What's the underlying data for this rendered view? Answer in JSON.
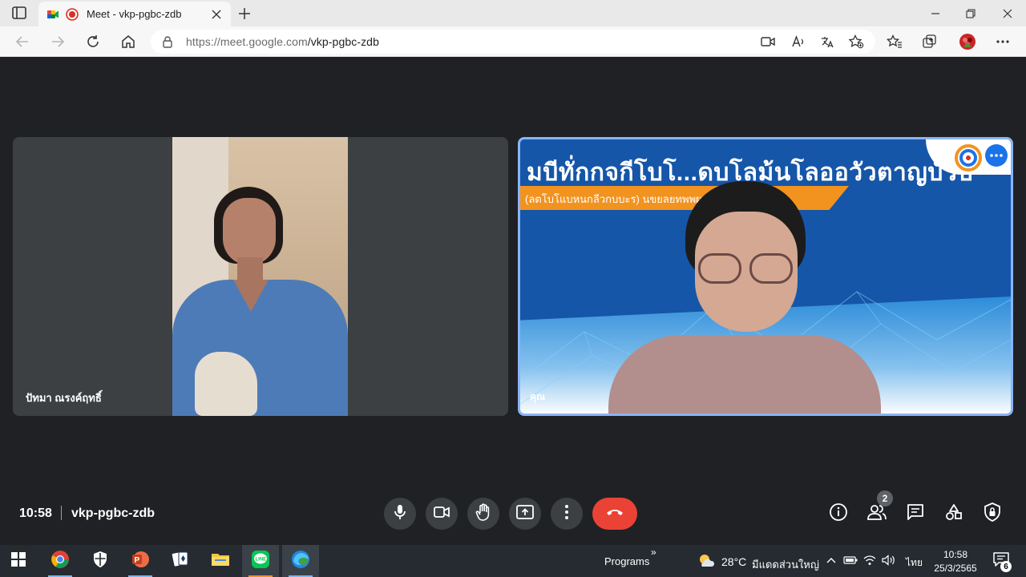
{
  "browser": {
    "tab_title": "Meet - vkp-pgbc-zdb",
    "url_host": "https://meet.google.com",
    "url_path": "/vkp-pgbc-zdb"
  },
  "meet": {
    "time": "10:58",
    "meeting_code": "vkp-pgbc-zdb",
    "participant_count": "2",
    "participants": [
      {
        "name": "ปัทมา ณรงค์ฤทธิ์"
      },
      {
        "name": "คุณ"
      }
    ],
    "slide": {
      "title": "มบีทั่กกจกีโบโ...ดบโลม้นโลออวัวตาญบัวป",
      "subtitle": "(ลตโบโแบหนกลีวกบบะร) นขยลยทพพผลงน...ตวตจีวาสล"
    },
    "colors": {
      "end_call": "#ea4335",
      "control_bg": "#3c4043",
      "active_border": "#8ab4f8",
      "stage_bg": "#202124"
    }
  },
  "taskbar": {
    "programs_label": "Programs",
    "chevron": "»",
    "temperature": "28°C",
    "weather_text": "มีแดดส่วนใหญ่",
    "language": "ไทย",
    "clock_time": "10:58",
    "clock_date": "25/3/2565",
    "notification_count": "6"
  }
}
